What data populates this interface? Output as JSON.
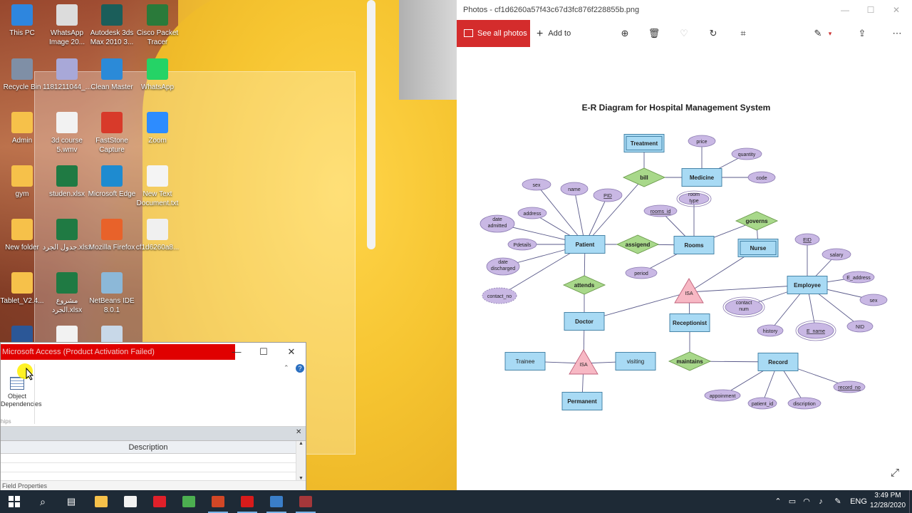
{
  "desktop": {
    "icons": [
      {
        "label": "This PC",
        "icon": "this-pc-icon",
        "color": "#2e86de"
      },
      {
        "label": "Recycle Bin",
        "icon": "recycle-bin-icon",
        "color": "#7f8fa6"
      },
      {
        "label": "Admin",
        "icon": "user-folder-icon",
        "color": "#f6c14a"
      },
      {
        "label": "gym",
        "icon": "folder-icon",
        "color": "#f6c14a"
      },
      {
        "label": "New folder",
        "icon": "folder-icon",
        "color": "#f6c14a"
      },
      {
        "label": "Tablet_V2.4...",
        "icon": "folder-icon",
        "color": "#f6c14a"
      },
      {
        "label": "WhatsApp Image 20...",
        "icon": "image-file-icon",
        "color": "#dcdcdc"
      },
      {
        "label": "1181211044_...",
        "icon": "image-file-icon",
        "color": "#a8a8d8"
      },
      {
        "label": "3d course 5.wmv",
        "icon": "video-file-icon",
        "color": "#f2f2f2"
      },
      {
        "label": "studen.xlsx",
        "icon": "excel-file-icon",
        "color": "#1f7a43"
      },
      {
        "label": "جدول الجرد.xlsx",
        "icon": "excel-file-icon",
        "color": "#1f7a43"
      },
      {
        "label": "مشروع الجرد.xlsx",
        "icon": "excel-file-icon",
        "color": "#1f7a43"
      },
      {
        "label": "Autodesk 3ds Max 2010 3...",
        "icon": "3ds-max-icon",
        "color": "#1b5e5a"
      },
      {
        "label": "Clean Master",
        "icon": "clean-master-icon",
        "color": "#2b8ad8"
      },
      {
        "label": "FastStone Capture",
        "icon": "faststone-icon",
        "color": "#d83a2a"
      },
      {
        "label": "Microsoft Edge",
        "icon": "edge-icon",
        "color": "#1e8bd0"
      },
      {
        "label": "Mozilla Firefox",
        "icon": "firefox-icon",
        "color": "#e8622a"
      },
      {
        "label": "NetBeans IDE 8.0.1",
        "icon": "netbeans-icon",
        "color": "#8cb8d8"
      },
      {
        "label": "Cisco Packet Tracer",
        "icon": "packet-tracer-icon",
        "color": "#2a7a3a"
      },
      {
        "label": "WhatsApp",
        "icon": "whatsapp-icon",
        "color": "#25d366"
      },
      {
        "label": "Zoom",
        "icon": "zoom-icon",
        "color": "#2d8cff"
      },
      {
        "label": "New Text Document.txt",
        "icon": "text-file-icon",
        "color": "#f4f4f4"
      },
      {
        "label": "cf1d6260a8...",
        "icon": "image-file-icon",
        "color": "#f0f0f0"
      },
      {
        "label": "",
        "icon": "word-file-icon",
        "color": "#2b5797"
      },
      {
        "label": "",
        "icon": "file-icon",
        "color": "#f2f2f2"
      },
      {
        "label": "",
        "icon": "file-icon",
        "color": "#c8d8e8"
      }
    ]
  },
  "access": {
    "title": "Microsoft Access (Product Activation Failed)",
    "minimize": "—",
    "maximize": "☐",
    "close": "✕",
    "object_dependencies": "Object Dependencies",
    "relationships_fragment": "hips",
    "panel_close": "✕",
    "description_header": "Description",
    "field_properties": "Field Properties"
  },
  "photos": {
    "title": "Photos - cf1d6260a57f43c67d3fc876f228855b.png",
    "see_all": "See all photos",
    "add_to": "Add to",
    "diagram": {
      "title": "E-R Diagram for Hospital Management System",
      "entities": [
        "Treatment",
        "Medicine",
        "Patient",
        "Rooms",
        "Nurse",
        "Employee",
        "Doctor",
        "Receptionist",
        "Trainee",
        "visiting",
        "Permanent",
        "Record"
      ],
      "relationships": [
        "bill",
        "assigend",
        "governs",
        "attends",
        "maintains"
      ],
      "isa": [
        "ISA",
        "ISA"
      ],
      "attributes": [
        "price",
        "quantity",
        "code",
        "sex",
        "name",
        "PID",
        "room type",
        "rooms_id",
        "address",
        "date admitted",
        "Pdetails",
        "date discharged",
        "contact_no",
        "period",
        "EID",
        "salary",
        "E_address",
        "sex",
        "contact num",
        "history",
        "E_name",
        "NID",
        "appoinment",
        "patient_id",
        "discription",
        "record_no"
      ]
    }
  },
  "taskbar": {
    "apps": [
      {
        "name": "file-explorer-icon",
        "color": "#f6c14a"
      },
      {
        "name": "store-icon",
        "color": "#f2f2f2"
      },
      {
        "name": "opera-icon",
        "color": "#e0202a"
      },
      {
        "name": "chrome-icon",
        "color": "#4caf50"
      },
      {
        "name": "powerpoint-icon",
        "color": "#d24726"
      },
      {
        "name": "acrobat-icon",
        "color": "#d81b1b"
      },
      {
        "name": "photos-icon",
        "color": "#3a7ec8"
      },
      {
        "name": "access-icon",
        "color": "#a4373a"
      }
    ],
    "language": "ENG",
    "time": "3:49 PM",
    "date": "12/28/2020"
  }
}
